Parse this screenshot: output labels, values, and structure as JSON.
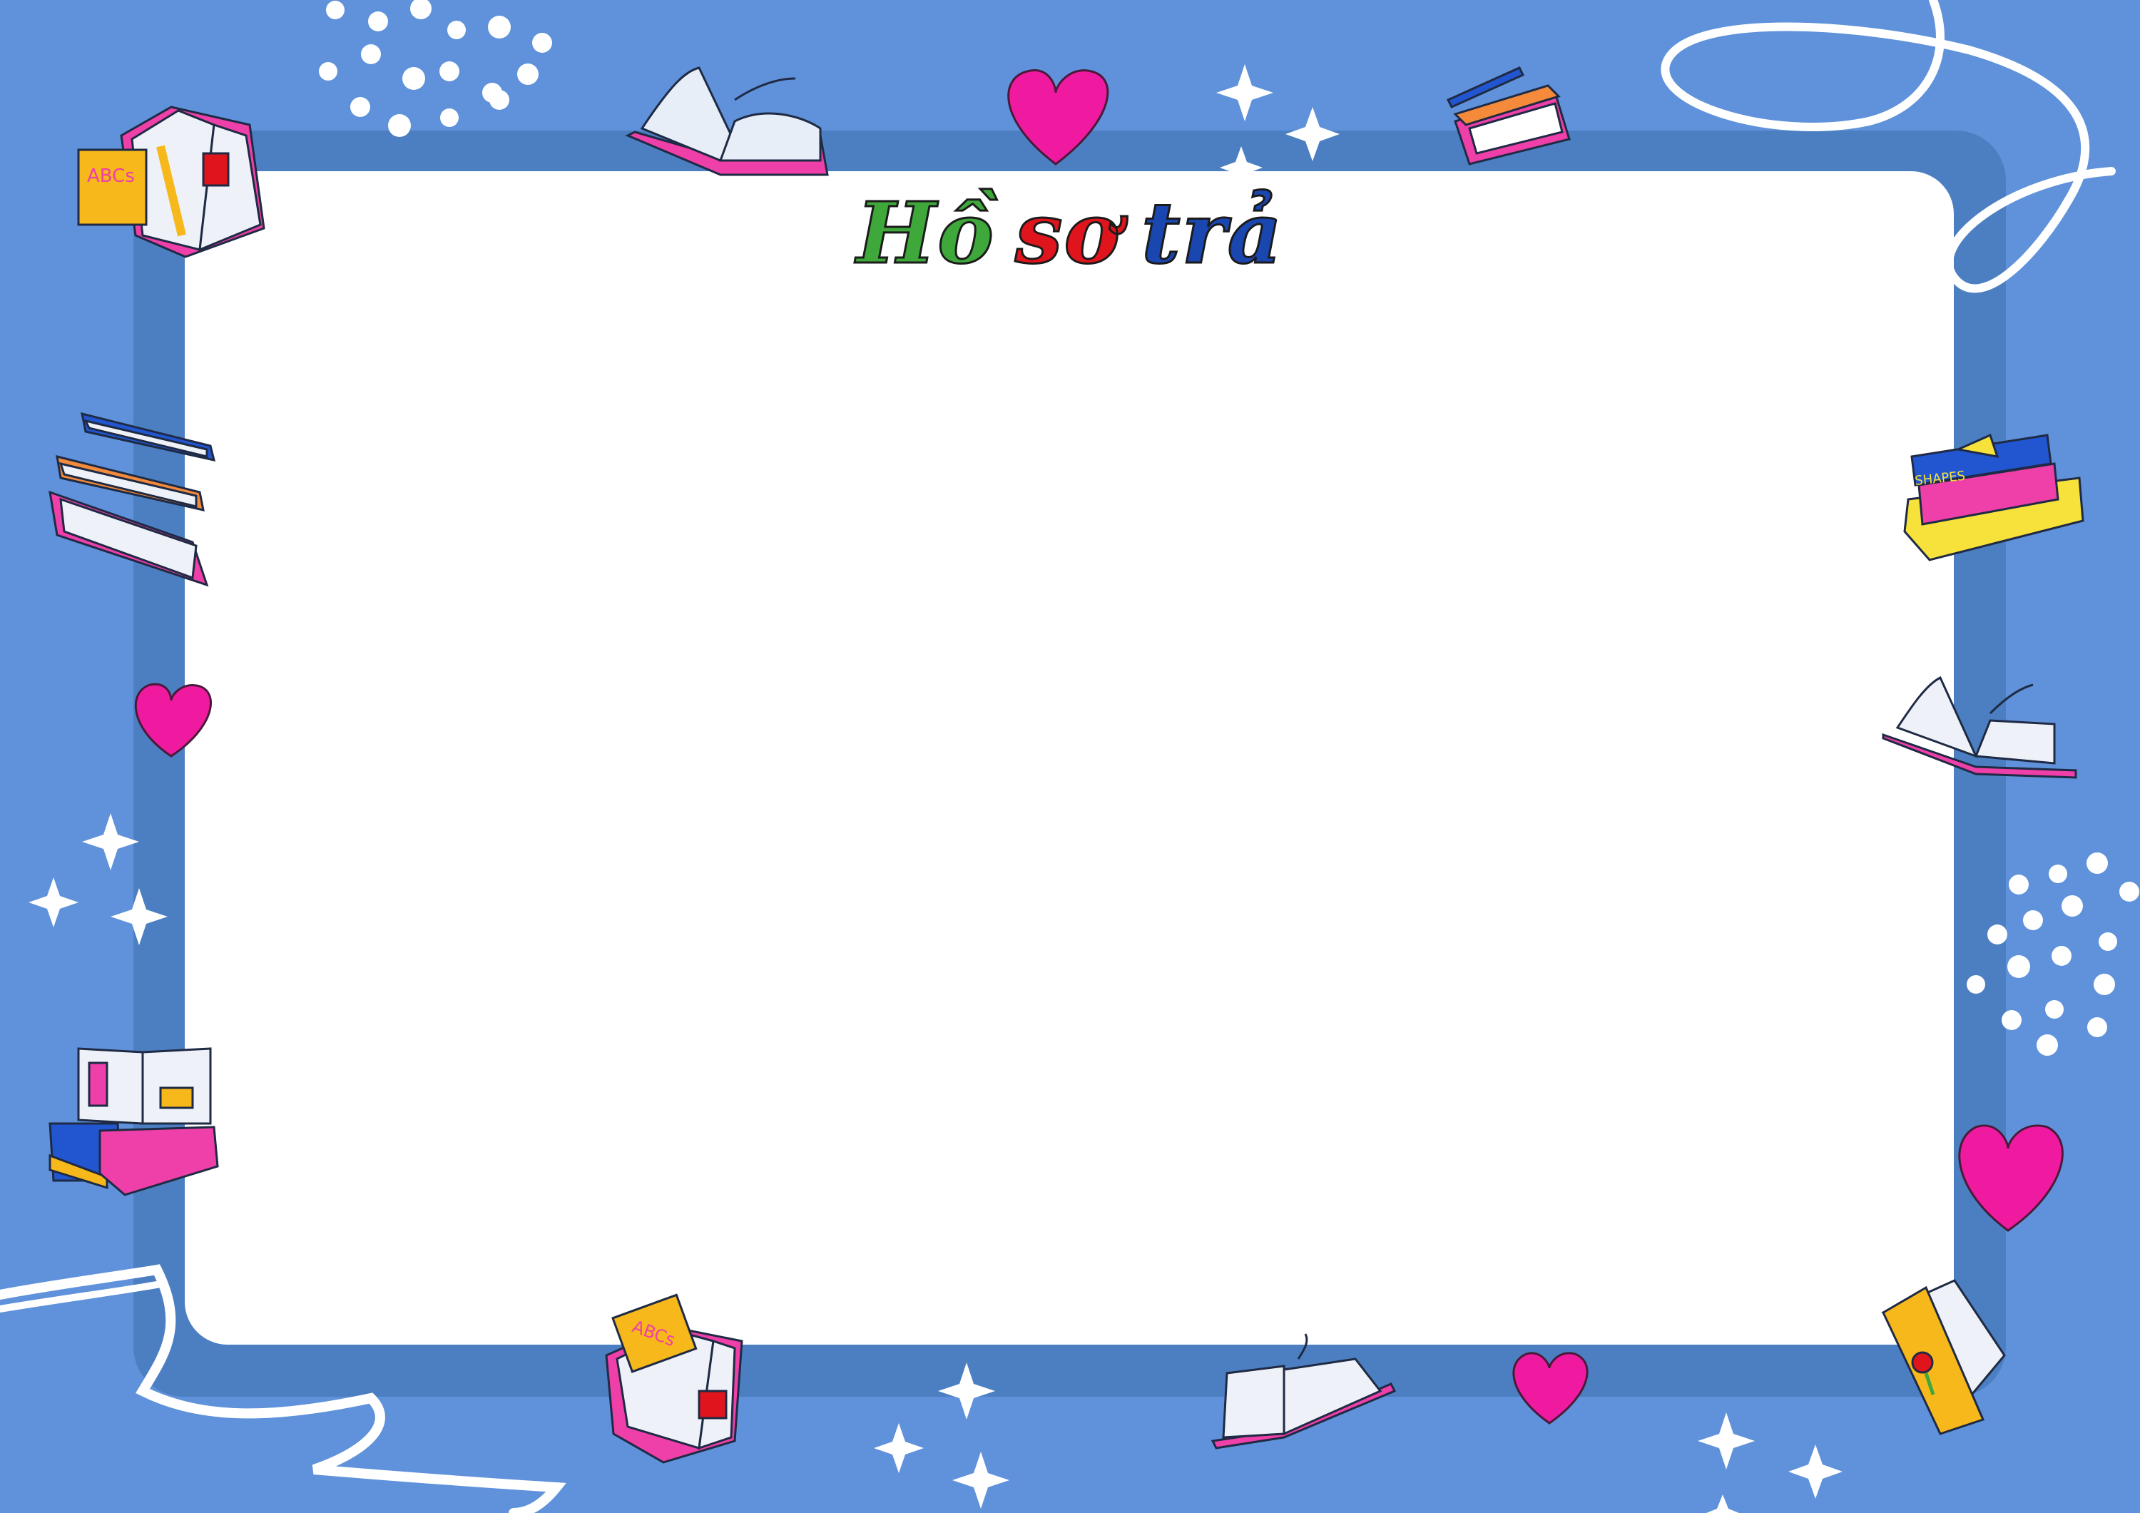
{
  "title": {
    "word1": "Hồ",
    "word2": "sơ",
    "word3": "trả"
  },
  "colors": {
    "background": "#5f92da",
    "frame": "#4c7fc1",
    "paper": "#ffffff",
    "heart": "#f01aa0",
    "word1": "#3fa83b",
    "word2": "#e0141c",
    "word3": "#1a46b0"
  },
  "decorations": {
    "book_labels": [
      "ABCs",
      "SHAPES",
      "ABCs"
    ]
  }
}
